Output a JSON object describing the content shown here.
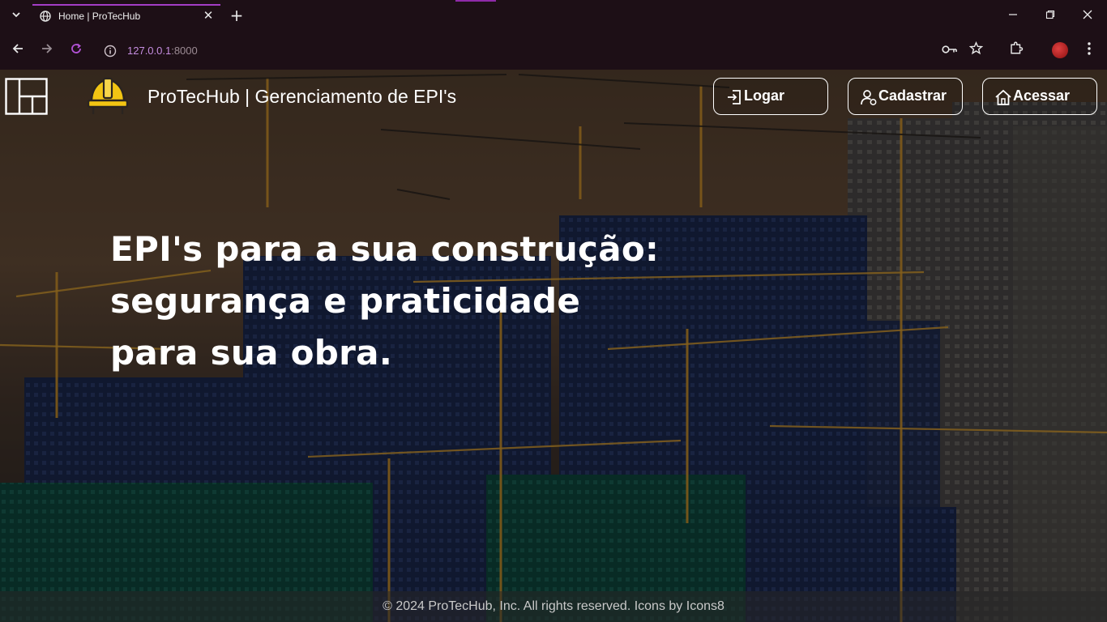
{
  "browser": {
    "tab_title": "Home | ProTecHub",
    "url_host": "127.0.0.1",
    "url_port": ":8000",
    "icons": {
      "tab_search": "chevron-down-icon",
      "back": "arrow-left-icon",
      "forward": "arrow-right-icon",
      "reload": "reload-icon",
      "site_info": "info-icon",
      "password": "key-icon",
      "bookmark": "star-icon",
      "extensions": "puzzle-icon",
      "menu": "kebab-menu-icon"
    }
  },
  "nav": {
    "brand_title": "ProTecHub | Gerenciamento de EPI's",
    "buttons": [
      {
        "label": "Logar",
        "icon": "login-icon"
      },
      {
        "label": "Cadastrar",
        "icon": "user-add-icon"
      },
      {
        "label": "Acessar",
        "icon": "home-icon"
      }
    ]
  },
  "hero": {
    "lines": [
      "EPI's para a sua construção:",
      "segurança e praticidade",
      "para sua obra."
    ]
  },
  "footer": {
    "text": "© 2024 ProTecHub, Inc. All rights reserved. Icons by Icons8"
  },
  "colors": {
    "accent": "#a33dc6",
    "url_host": "#c58de0",
    "helmet": "#f2c513"
  }
}
